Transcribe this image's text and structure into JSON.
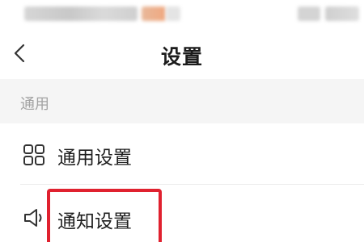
{
  "nav": {
    "title": "设置",
    "back_icon": "chevron-left-icon"
  },
  "section": {
    "label": "通用"
  },
  "rows": [
    {
      "label": "通用设置",
      "icon": "grid-icon"
    },
    {
      "label": "通知设置",
      "icon": "speaker-icon"
    }
  ],
  "colors": {
    "highlight": "#e0212f",
    "section_bg": "#f5f5f5",
    "section_text": "#a3a3a3"
  }
}
